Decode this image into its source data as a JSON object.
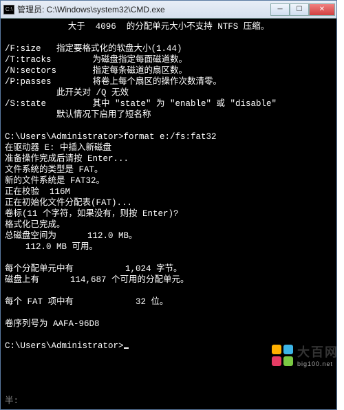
{
  "window": {
    "title": "管理员: C:\\Windows\\system32\\CMD.exe"
  },
  "header": "大于  4096  的分配单元大小不支持 NTFS 压缩。",
  "opts": [
    {
      "flag": "/F:size",
      "desc": "   指定要格式化的软盘大小(1.44)"
    },
    {
      "flag": "/T:tracks",
      "desc": "        为磁盘指定每面磁道数。"
    },
    {
      "flag": "/N:sectors",
      "desc": "       指定每条磁道的扇区数。"
    },
    {
      "flag": "/P:passes",
      "desc": "        将卷上每个扇区的操作次数清零。"
    },
    {
      "flag": "",
      "desc": "          此开关对 /Q 无效"
    },
    {
      "flag": "/S:state",
      "desc": "         其中 \"state\" 为 \"enable\" 或 \"disable\""
    },
    {
      "flag": "",
      "desc": "          默认情况下启用了短名称"
    }
  ],
  "prompt1": "C:\\Users\\Administrator>",
  "cmd1": "format e:/fs:fat32",
  "out": [
    "在驱动器 E: 中插入新磁盘",
    "准备操作完成后请按 Enter...",
    "文件系统的类型是 FAT。",
    "新的文件系统是 FAT32。",
    "正在校验  116M",
    "正在初始化文件分配表(FAT)...",
    "卷标(11 个字符，如果没有，则按 Enter)?",
    "格式化已完成。",
    "总磁盘空间为      112.0 MB。",
    "    112.0 MB 可用。",
    "",
    "每个分配单元中有          1,024 字节。",
    "磁盘上有      114,687 个可用的分配单元。",
    "",
    "每个 FAT 项中有            32 位。",
    "",
    "卷序列号为 AAFA-96D8"
  ],
  "prompt2": "C:\\Users\\Administrator>",
  "half": "半:",
  "watermark": {
    "name": "大百网",
    "url": "big100.net"
  }
}
